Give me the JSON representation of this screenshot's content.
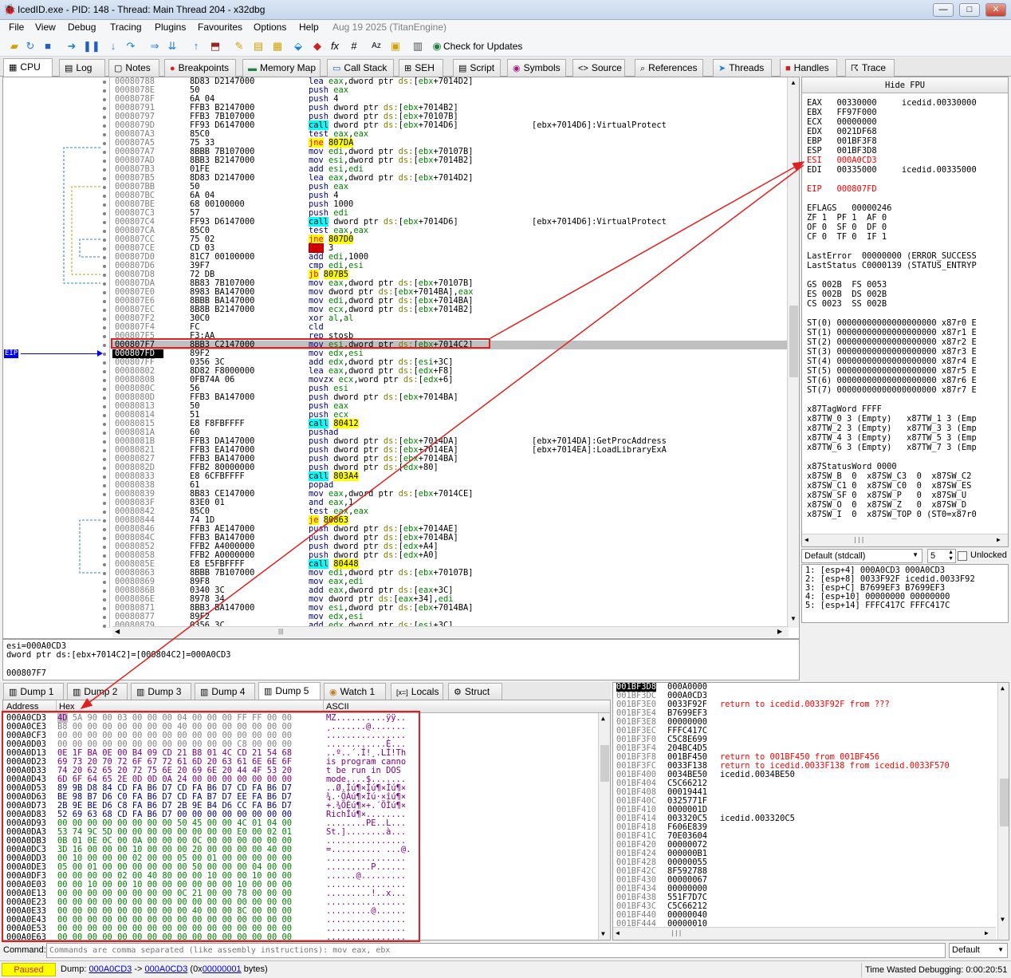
{
  "window": {
    "title": "IcedID.exe - PID: 148 - Thread: Main Thread 204 - x32dbg",
    "app_icon": "bug-icon",
    "buttons": [
      "minimize",
      "maximize",
      "close"
    ]
  },
  "menu": [
    "File",
    "View",
    "Debug",
    "Tracing",
    "Plugins",
    "Favourites",
    "Options",
    "Help",
    "Aug 19 2025 (TitanEngine)"
  ],
  "toolbar": {
    "check_updates": "Check for Updates"
  },
  "tabs": [
    "CPU",
    "Log",
    "Notes",
    "Breakpoints",
    "Memory Map",
    "Call Stack",
    "SEH",
    "Script",
    "Symbols",
    "Source",
    "References",
    "Threads",
    "Handles",
    "Trace"
  ],
  "disasm": [
    {
      "a": "00080788",
      "b": "8D83 D2147000",
      "i": "lea eax,dword ptr ds:[ebx+7014D2]",
      "c": ""
    },
    {
      "a": "0008078E",
      "b": "50",
      "i": "push eax",
      "c": ""
    },
    {
      "a": "0008078F",
      "b": "6A 04",
      "i": "push 4",
      "c": ""
    },
    {
      "a": "00080791",
      "b": "FFB3 B2147000",
      "i": "push dword ptr ds:[ebx+7014B2]",
      "c": ""
    },
    {
      "a": "00080797",
      "b": "FFB3 7B107000",
      "i": "push dword ptr ds:[ebx+70107B]",
      "c": ""
    },
    {
      "a": "0008079D",
      "b": "FF93 D6147000",
      "i": "call dword ptr ds:[ebx+7014D6]",
      "c": "[ebx+7014D6]:VirtualProtect",
      "k": "call"
    },
    {
      "a": "000807A3",
      "b": "85C0",
      "i": "test eax,eax",
      "c": ""
    },
    {
      "a": "000807A5",
      "b": "75 33",
      "i": "jne 807DA",
      "c": "",
      "k": "jcc"
    },
    {
      "a": "000807A7",
      "b": "8BBB 7B107000",
      "i": "mov edi,dword ptr ds:[ebx+70107B]",
      "c": ""
    },
    {
      "a": "000807AD",
      "b": "8BB3 B2147000",
      "i": "mov esi,dword ptr ds:[ebx+7014B2]",
      "c": ""
    },
    {
      "a": "000807B3",
      "b": "01FE",
      "i": "add esi,edi",
      "c": ""
    },
    {
      "a": "000807B5",
      "b": "8D83 D2147000",
      "i": "lea eax,dword ptr ds:[ebx+7014D2]",
      "c": ""
    },
    {
      "a": "000807BB",
      "b": "50",
      "i": "push eax",
      "c": ""
    },
    {
      "a": "000807BC",
      "b": "6A 04",
      "i": "push 4",
      "c": ""
    },
    {
      "a": "000807BE",
      "b": "68 00100000",
      "i": "push 1000",
      "c": ""
    },
    {
      "a": "000807C3",
      "b": "57",
      "i": "push edi",
      "c": ""
    },
    {
      "a": "000807C4",
      "b": "FF93 D6147000",
      "i": "call dword ptr ds:[ebx+7014D6]",
      "c": "[ebx+7014D6]:VirtualProtect",
      "k": "call"
    },
    {
      "a": "000807CA",
      "b": "85C0",
      "i": "test eax,eax",
      "c": ""
    },
    {
      "a": "000807CC",
      "b": "75 02",
      "i": "jne 807D0",
      "c": "",
      "k": "jcc"
    },
    {
      "a": "000807CE",
      "b": "CD 03",
      "i": "int 3",
      "c": "",
      "k": "int"
    },
    {
      "a": "000807D0",
      "b": "81C7 00100000",
      "i": "add edi,1000",
      "c": ""
    },
    {
      "a": "000807D6",
      "b": "39F7",
      "i": "cmp edi,esi",
      "c": ""
    },
    {
      "a": "000807D8",
      "b": "72 DB",
      "i": "jb 807B5",
      "c": "",
      "k": "jcc"
    },
    {
      "a": "000807DA",
      "b": "8B83 7B107000",
      "i": "mov eax,dword ptr ds:[ebx+70107B]",
      "c": ""
    },
    {
      "a": "000807E0",
      "b": "8983 BA147000",
      "i": "mov dword ptr ds:[ebx+7014BA],eax",
      "c": ""
    },
    {
      "a": "000807E6",
      "b": "8BBB BA147000",
      "i": "mov edi,dword ptr ds:[ebx+7014BA]",
      "c": ""
    },
    {
      "a": "000807EC",
      "b": "8B8B B2147000",
      "i": "mov ecx,dword ptr ds:[ebx+7014B2]",
      "c": ""
    },
    {
      "a": "000807F2",
      "b": "30C0",
      "i": "xor al,al",
      "c": ""
    },
    {
      "a": "000807F4",
      "b": "FC",
      "i": "cld",
      "c": ""
    },
    {
      "a": "000807F5",
      "b": "F3:AA",
      "i": "rep stosb",
      "c": ""
    },
    {
      "a": "000807F7",
      "b": "8BB3 C2147000",
      "i": "mov esi,dword ptr ds:[ebx+7014C2]",
      "c": ""
    },
    {
      "a": "000807FD",
      "b": "89F2",
      "i": "mov edx,esi",
      "c": ""
    },
    {
      "a": "000807FF",
      "b": "0356 3C",
      "i": "add edx,dword ptr ds:[esi+3C]",
      "c": ""
    },
    {
      "a": "00080802",
      "b": "8D82 F8000000",
      "i": "lea eax,dword ptr ds:[edx+F8]",
      "c": ""
    },
    {
      "a": "00080808",
      "b": "0FB74A 06",
      "i": "movzx ecx,word ptr ds:[edx+6]",
      "c": ""
    },
    {
      "a": "0008080C",
      "b": "56",
      "i": "push esi",
      "c": ""
    },
    {
      "a": "0008080D",
      "b": "FFB3 BA147000",
      "i": "push dword ptr ds:[ebx+7014BA]",
      "c": ""
    },
    {
      "a": "00080813",
      "b": "50",
      "i": "push eax",
      "c": ""
    },
    {
      "a": "00080814",
      "b": "51",
      "i": "push ecx",
      "c": ""
    },
    {
      "a": "00080815",
      "b": "E8 F8FBFFFF",
      "i": "call 80412",
      "c": "",
      "k": "call"
    },
    {
      "a": "0008081A",
      "b": "60",
      "i": "pushad",
      "c": ""
    },
    {
      "a": "0008081B",
      "b": "FFB3 DA147000",
      "i": "push dword ptr ds:[ebx+7014DA]",
      "c": "[ebx+7014DA]:GetProcAddress"
    },
    {
      "a": "00080821",
      "b": "FFB3 EA147000",
      "i": "push dword ptr ds:[ebx+7014EA]",
      "c": "[ebx+7014EA]:LoadLibraryExA"
    },
    {
      "a": "00080827",
      "b": "FFB3 BA147000",
      "i": "push dword ptr ds:[ebx+7014BA]",
      "c": ""
    },
    {
      "a": "0008082D",
      "b": "FFB2 80000000",
      "i": "push dword ptr ds:[edx+80]",
      "c": ""
    },
    {
      "a": "00080833",
      "b": "E8 6CFBFFFF",
      "i": "call 803A4",
      "c": "",
      "k": "call"
    },
    {
      "a": "00080838",
      "b": "61",
      "i": "popad",
      "c": ""
    },
    {
      "a": "00080839",
      "b": "8B83 CE147000",
      "i": "mov eax,dword ptr ds:[ebx+7014CE]",
      "c": ""
    },
    {
      "a": "0008083F",
      "b": "83E0 01",
      "i": "and eax,1",
      "c": ""
    },
    {
      "a": "00080842",
      "b": "85C0",
      "i": "test eax,eax",
      "c": ""
    },
    {
      "a": "00080844",
      "b": "74 1D",
      "i": "je 80863",
      "c": "",
      "k": "jcc"
    },
    {
      "a": "00080846",
      "b": "FFB3 AE147000",
      "i": "push dword ptr ds:[ebx+7014AE]",
      "c": ""
    },
    {
      "a": "0008084C",
      "b": "FFB3 BA147000",
      "i": "push dword ptr ds:[ebx+7014BA]",
      "c": ""
    },
    {
      "a": "00080852",
      "b": "FFB2 A4000000",
      "i": "push dword ptr ds:[edx+A4]",
      "c": ""
    },
    {
      "a": "00080858",
      "b": "FFB2 A0000000",
      "i": "push dword ptr ds:[edx+A0]",
      "c": ""
    },
    {
      "a": "0008085E",
      "b": "E8 E5FBFFFF",
      "i": "call 80448",
      "c": "",
      "k": "call"
    },
    {
      "a": "00080863",
      "b": "8BBB 7B107000",
      "i": "mov edi,dword ptr ds:[ebx+70107B]",
      "c": ""
    },
    {
      "a": "00080869",
      "b": "89F8",
      "i": "mov eax,edi",
      "c": ""
    },
    {
      "a": "0008086B",
      "b": "0340 3C",
      "i": "add eax,dword ptr ds:[eax+3C]",
      "c": ""
    },
    {
      "a": "0008086E",
      "b": "8978 34",
      "i": "mov dword ptr ds:[eax+34],edi",
      "c": ""
    },
    {
      "a": "00080871",
      "b": "8BB3 BA147000",
      "i": "mov esi,dword ptr ds:[ebx+7014BA]",
      "c": ""
    },
    {
      "a": "00080877",
      "b": "89F2",
      "i": "mov edx,esi",
      "c": ""
    },
    {
      "a": "00080879",
      "b": "0356 3C",
      "i": "add edx,dword ptr ds:[esi+3C]",
      "c": ""
    }
  ],
  "eip_label": "EIP",
  "info": {
    "line1": "esi=000A0CD3",
    "line2": "dword ptr ds:[ebx+7014C2]=[000804C2]=000A0CD3",
    "line3": "000807F7"
  },
  "registers": {
    "hide_fpu": "Hide FPU",
    "lines": [
      {
        "t": "EAX   00330000     icedid.00330000",
        "red": false
      },
      {
        "t": "EBX   FF97F000",
        "red": false
      },
      {
        "t": "ECX   00000000",
        "red": false
      },
      {
        "t": "EDX   0021DF68",
        "red": false
      },
      {
        "t": "EBP   001BF3F8",
        "red": false
      },
      {
        "t": "ESP   001BF3D8",
        "red": false
      },
      {
        "t": "ESI   000A0CD3",
        "red": true
      },
      {
        "t": "EDI   00335000     icedid.00335000",
        "red": false
      },
      {
        "t": "",
        "red": false
      },
      {
        "t": "EIP   000807FD",
        "red": true
      },
      {
        "t": "",
        "red": false
      },
      {
        "t": "EFLAGS   00000246",
        "red": false
      },
      {
        "t": "ZF 1  PF 1  AF 0",
        "red": false
      },
      {
        "t": "OF 0  SF 0  DF 0",
        "red": false
      },
      {
        "t": "CF 0  TF 0  IF 1",
        "red": false
      },
      {
        "t": "",
        "red": false
      },
      {
        "t": "LastError  00000000 (ERROR_SUCCESS",
        "red": false
      },
      {
        "t": "LastStatus C0000139 (STATUS_ENTRYP",
        "red": false
      },
      {
        "t": "",
        "red": false
      },
      {
        "t": "GS 002B  FS 0053",
        "red": false
      },
      {
        "t": "ES 002B  DS 002B",
        "red": false
      },
      {
        "t": "CS 0023  SS 002B",
        "red": false
      },
      {
        "t": "",
        "red": false
      },
      {
        "t": "ST(0) 00000000000000000000 x87r0 E",
        "red": false
      },
      {
        "t": "ST(1) 00000000000000000000 x87r1 E",
        "red": false
      },
      {
        "t": "ST(2) 00000000000000000000 x87r2 E",
        "red": false
      },
      {
        "t": "ST(3) 00000000000000000000 x87r3 E",
        "red": false
      },
      {
        "t": "ST(4) 00000000000000000000 x87r4 E",
        "red": false
      },
      {
        "t": "ST(5) 00000000000000000000 x87r5 E",
        "red": false
      },
      {
        "t": "ST(6) 00000000000000000000 x87r6 E",
        "red": false
      },
      {
        "t": "ST(7) 00000000000000000000 x87r7 E",
        "red": false
      },
      {
        "t": "",
        "red": false
      },
      {
        "t": "x87TagWord FFFF",
        "red": false
      },
      {
        "t": "x87TW_0 3 (Empty)   x87TW_1 3 (Emp",
        "red": false
      },
      {
        "t": "x87TW_2 3 (Empty)   x87TW_3 3 (Emp",
        "red": false
      },
      {
        "t": "x87TW_4 3 (Empty)   x87TW_5 3 (Emp",
        "red": false
      },
      {
        "t": "x87TW_6 3 (Empty)   x87TW_7 3 (Emp",
        "red": false
      },
      {
        "t": "",
        "red": false
      },
      {
        "t": "x87StatusWord 0000",
        "red": false
      },
      {
        "t": "x87SW_B  0  x87SW_C3  0  x87SW_C2",
        "red": false
      },
      {
        "t": "x87SW_C1 0  x87SW_C0  0  x87SW_ES",
        "red": false
      },
      {
        "t": "x87SW_SF 0  x87SW_P   0  x87SW_U",
        "red": false
      },
      {
        "t": "x87SW_O  0  x87SW_Z   0  x87SW_D",
        "red": false
      },
      {
        "t": "x87SW_I  0  x87SW_TOP 0 (ST0=x87r0",
        "red": false
      }
    ]
  },
  "callconv": {
    "selected": "Default (stdcall)",
    "count": "5",
    "unlocked": "Unlocked"
  },
  "stackargs": [
    "1: [esp+4] 000A0CD3 000A0CD3",
    "2: [esp+8] 0033F92F icedid.0033F92",
    "3: [esp+C] B7699EF3 B7699EF3",
    "4: [esp+10] 00000000 00000000",
    "5: [esp+14] FFFC417C FFFC417C"
  ],
  "dumptabs": [
    "Dump 1",
    "Dump 2",
    "Dump 3",
    "Dump 4",
    "Dump 5",
    "Watch 1",
    "Locals",
    "Struct"
  ],
  "dump_headers": {
    "address": "Address",
    "hex": "Hex",
    "ascii": "ASCII"
  },
  "dump": [
    {
      "a": "000A0CD3",
      "h": "4D 5A 90 00 03 00 00 00 04 00 00 00 FF FF 00 00",
      "s": "MZ..........ÿÿ.."
    },
    {
      "a": "000A0CE3",
      "h": "B8 00 00 00 00 00 00 00 40 00 00 00 00 00 00 00",
      "s": "¸.......@......."
    },
    {
      "a": "000A0CF3",
      "h": "00 00 00 00 00 00 00 00 00 00 00 00 00 00 00 00",
      "s": "................"
    },
    {
      "a": "000A0D03",
      "h": "00 00 00 00 00 00 00 00 00 00 00 00 C8 00 00 00",
      "s": "............È..."
    },
    {
      "a": "000A0D13",
      "h": "0E 1F BA 0E 00 B4 09 CD 21 B8 01 4C CD 21 54 68",
      "s": "..º..´.Í!¸.LÍ!Th"
    },
    {
      "a": "000A0D23",
      "h": "69 73 20 70 72 6F 67 72 61 6D 20 63 61 6E 6E 6F",
      "s": "is program canno"
    },
    {
      "a": "000A0D33",
      "h": "74 20 62 65 20 72 75 6E 20 69 6E 20 44 4F 53 20",
      "s": "t be run in DOS "
    },
    {
      "a": "000A0D43",
      "h": "6D 6F 64 65 2E 0D 0D 0A 24 00 00 00 00 00 00 00",
      "s": "mode....$......."
    },
    {
      "a": "000A0D53",
      "h": "89 9B D8 84 CD FA B6 D7 CD FA B6 D7 CD FA B6 D7",
      "s": "..Ø.Íú¶×Íú¶×Íú¶×"
    },
    {
      "a": "000A0D63",
      "h": "BE 98 B7 D6 C0 FA B6 D7 CD FA B7 D7 EE FA B6 D7",
      "s": "¾.·ÖÀú¶×Íú·×îú¶×"
    },
    {
      "a": "000A0D73",
      "h": "2B 9E BE D6 C8 FA B6 D7 2B 9E B4 D6 CC FA B6 D7",
      "s": "+.¾ÖÈú¶×+.´ÖÌú¶×"
    },
    {
      "a": "000A0D83",
      "h": "52 69 63 68 CD FA B6 D7 00 00 00 00 00 00 00 00",
      "s": "RichÍú¶×........"
    },
    {
      "a": "000A0D93",
      "h": "00 00 00 00 00 00 00 00 50 45 00 00 4C 01 04 00",
      "s": "........PE..L..."
    },
    {
      "a": "000A0DA3",
      "h": "53 74 9C 5D 00 00 00 00 00 00 00 00 E0 00 02 01",
      "s": "St.]........à..."
    },
    {
      "a": "000A0DB3",
      "h": "0B 01 0E 0C 00 0A 00 00 00 0C 00 00 00 00 00 00",
      "s": "................"
    },
    {
      "a": "000A0DC3",
      "h": "3D 16 00 00 00 10 00 00 00 20 00 00 00 00 40 00",
      "s": "=.......... ...@."
    },
    {
      "a": "000A0DD3",
      "h": "00 10 00 00 00 02 00 00 05 00 01 00 00 00 00 00",
      "s": "................"
    },
    {
      "a": "000A0DE3",
      "h": "05 00 01 00 00 00 00 00 00 50 00 00 00 04 00 00",
      "s": ".........P......"
    },
    {
      "a": "000A0DF3",
      "h": "00 00 00 00 02 00 40 80 00 00 10 00 00 10 00 00",
      "s": "......@........."
    },
    {
      "a": "000A0E03",
      "h": "00 00 10 00 00 10 00 00 00 00 00 00 10 00 00 00",
      "s": "................"
    },
    {
      "a": "000A0E13",
      "h": "00 00 00 00 00 00 00 00 0C 21 00 00 78 00 00 00",
      "s": ".........!..x..."
    },
    {
      "a": "000A0E23",
      "h": "00 00 00 00 00 00 00 00 00 00 00 00 00 00 00 00",
      "s": "................"
    },
    {
      "a": "000A0E33",
      "h": "00 00 00 00 00 00 00 00 00 40 00 00 8C 00 00 00",
      "s": ".........@......"
    },
    {
      "a": "000A0E43",
      "h": "00 00 00 00 00 00 00 00 00 00 00 00 00 00 00 00",
      "s": "................"
    },
    {
      "a": "000A0E53",
      "h": "00 00 00 00 00 00 00 00 00 00 00 00 00 00 00 00",
      "s": "................"
    },
    {
      "a": "000A0E63",
      "h": "00 00 00 00 00 00 00 00 00 00 00 00 00 00 00 00",
      "s": "................"
    }
  ],
  "stack": [
    {
      "a": "001BF3D8",
      "v": "000A0000",
      "c": "",
      "sel": true
    },
    {
      "a": "001BF3DC",
      "v": "000A0CD3",
      "c": ""
    },
    {
      "a": "001BF3E0",
      "v": "0033F92F",
      "c": "return to icedid.0033F92F from ???",
      "red": true
    },
    {
      "a": "001BF3E4",
      "v": "B7699EF3",
      "c": ""
    },
    {
      "a": "001BF3E8",
      "v": "00000000",
      "c": ""
    },
    {
      "a": "001BF3EC",
      "v": "FFFC417C",
      "c": ""
    },
    {
      "a": "001BF3F0",
      "v": "C5C8E699",
      "c": ""
    },
    {
      "a": "001BF3F4",
      "v": "204BC4D5",
      "c": ""
    },
    {
      "a": "001BF3F8",
      "v": "001BF450",
      "c": "return to 001BF450 from 001BF456",
      "red": true
    },
    {
      "a": "001BF3FC",
      "v": "0033F138",
      "c": "return to icedid.0033F138 from icedid.0033F570",
      "red": true
    },
    {
      "a": "001BF400",
      "v": "0034BE50",
      "c": "icedid.0034BE50"
    },
    {
      "a": "001BF404",
      "v": "C5C66212",
      "c": ""
    },
    {
      "a": "001BF408",
      "v": "00019441",
      "c": ""
    },
    {
      "a": "001BF40C",
      "v": "0325771F",
      "c": ""
    },
    {
      "a": "001BF410",
      "v": "0000001D",
      "c": ""
    },
    {
      "a": "001BF414",
      "v": "003320C5",
      "c": "icedid.003320C5"
    },
    {
      "a": "001BF418",
      "v": "F606E839",
      "c": ""
    },
    {
      "a": "001BF41C",
      "v": "70E03604",
      "c": ""
    },
    {
      "a": "001BF420",
      "v": "00000072",
      "c": ""
    },
    {
      "a": "001BF424",
      "v": "000000B1",
      "c": ""
    },
    {
      "a": "001BF428",
      "v": "00000055",
      "c": ""
    },
    {
      "a": "001BF42C",
      "v": "8F592788",
      "c": ""
    },
    {
      "a": "001BF430",
      "v": "00000067",
      "c": ""
    },
    {
      "a": "001BF434",
      "v": "00000000",
      "c": ""
    },
    {
      "a": "001BF438",
      "v": "551F7D7C",
      "c": ""
    },
    {
      "a": "001BF43C",
      "v": "C5C66212",
      "c": ""
    },
    {
      "a": "001BF440",
      "v": "00000040",
      "c": ""
    },
    {
      "a": "001BF444",
      "v": "00000010",
      "c": ""
    }
  ],
  "cmd": {
    "label": "Command:",
    "placeholder": "Commands are comma separated (like assembly instructions): mov eax, ebx",
    "mode": "Default"
  },
  "status": {
    "state": "Paused",
    "dump_prefix": "Dump:",
    "dump_from": "000A0CD3",
    "arrow": "->",
    "dump_to": "000A0CD3",
    "size_open": "(0x",
    "size": "00000001",
    "size_close": "bytes)",
    "time": "Time Wasted Debugging: 0:00:20:51"
  },
  "colors": {
    "accent_red": "#e02020",
    "paused_bg": "#ffff00",
    "cyan_call": "#00ffff",
    "yellow_jmp": "#ffff00"
  }
}
